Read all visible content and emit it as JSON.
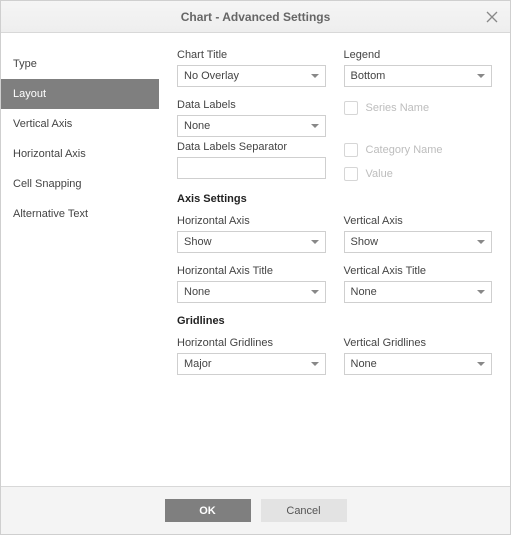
{
  "window": {
    "title": "Chart - Advanced Settings"
  },
  "nav": {
    "items": [
      "Type",
      "Layout",
      "Vertical Axis",
      "Horizontal Axis",
      "Cell Snapping",
      "Alternative Text"
    ],
    "active_index": 1
  },
  "layout": {
    "chart_title": {
      "label": "Chart Title",
      "value": "No Overlay"
    },
    "legend": {
      "label": "Legend",
      "value": "Bottom"
    },
    "data_labels": {
      "label": "Data Labels",
      "value": "None"
    },
    "series_name_label": "Series Name",
    "category_name_label": "Category Name",
    "value_label": "Value",
    "data_labels_separator": {
      "label": "Data Labels Separator",
      "value": ""
    },
    "axis_settings_heading": "Axis Settings",
    "horizontal_axis": {
      "label": "Horizontal Axis",
      "value": "Show"
    },
    "vertical_axis": {
      "label": "Vertical Axis",
      "value": "Show"
    },
    "horizontal_axis_title": {
      "label": "Horizontal Axis Title",
      "value": "None"
    },
    "vertical_axis_title": {
      "label": "Vertical Axis Title",
      "value": "None"
    },
    "gridlines_heading": "Gridlines",
    "horizontal_gridlines": {
      "label": "Horizontal Gridlines",
      "value": "Major"
    },
    "vertical_gridlines": {
      "label": "Vertical Gridlines",
      "value": "None"
    }
  },
  "footer": {
    "ok": "OK",
    "cancel": "Cancel"
  }
}
